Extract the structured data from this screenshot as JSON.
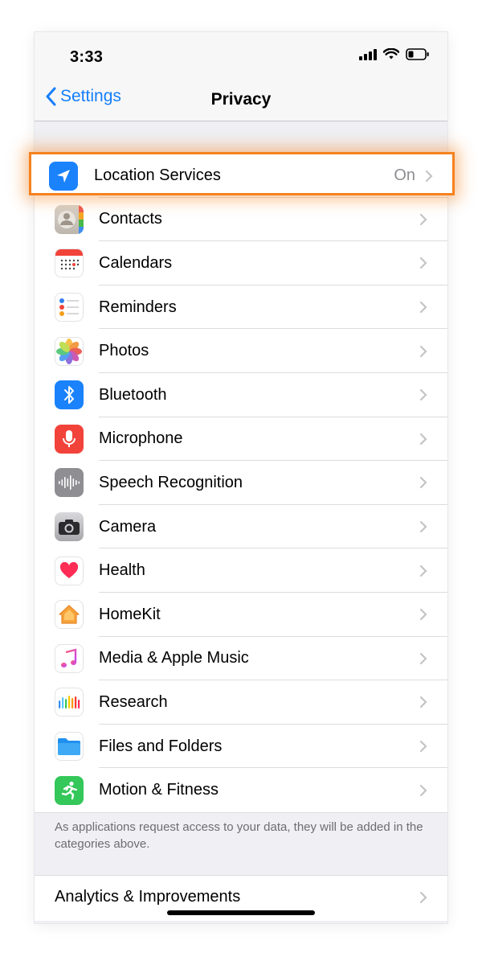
{
  "status_bar": {
    "time": "3:33"
  },
  "nav": {
    "back_label": "Settings",
    "title": "Privacy"
  },
  "location_services": {
    "label": "Location Services",
    "value": "On",
    "highlight_color": "#f5821f"
  },
  "rows": [
    {
      "label": "Contacts",
      "icon": "contacts-icon"
    },
    {
      "label": "Calendars",
      "icon": "calendar-icon"
    },
    {
      "label": "Reminders",
      "icon": "reminders-icon"
    },
    {
      "label": "Photos",
      "icon": "photos-icon"
    },
    {
      "label": "Bluetooth",
      "icon": "bluetooth-icon"
    },
    {
      "label": "Microphone",
      "icon": "microphone-icon"
    },
    {
      "label": "Speech Recognition",
      "icon": "speech-recognition-icon"
    },
    {
      "label": "Camera",
      "icon": "camera-icon"
    },
    {
      "label": "Health",
      "icon": "health-icon"
    },
    {
      "label": "HomeKit",
      "icon": "homekit-icon"
    },
    {
      "label": "Media & Apple Music",
      "icon": "music-icon"
    },
    {
      "label": "Research",
      "icon": "research-icon"
    },
    {
      "label": "Files and Folders",
      "icon": "files-icon"
    },
    {
      "label": "Motion & Fitness",
      "icon": "fitness-icon"
    }
  ],
  "footnote": "As applications request access to your data, they will be added in the categories above.",
  "analytics": {
    "label": "Analytics & Improvements"
  },
  "colors": {
    "accent": "#147efb",
    "background": "#efeff4",
    "secondary_text": "#8e8e93"
  }
}
